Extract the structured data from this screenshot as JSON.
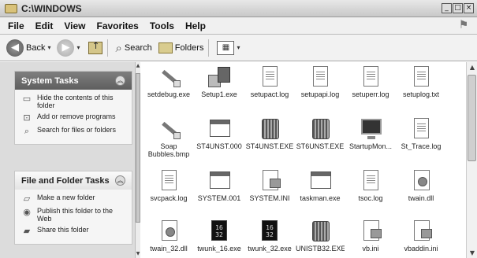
{
  "window": {
    "title": "C:\\WINDOWS",
    "controls": [
      "_",
      "□",
      "×"
    ]
  },
  "menu": {
    "items": [
      "File",
      "Edit",
      "View",
      "Favorites",
      "Tools",
      "Help"
    ]
  },
  "toolbar": {
    "back_label": "Back",
    "search_label": "Search",
    "folders_label": "Folders"
  },
  "sidebar": {
    "system_tasks": {
      "title": "System Tasks",
      "items": [
        {
          "label": "Hide the contents of this folder",
          "icon": "hide-contents-icon"
        },
        {
          "label": "Add or remove programs",
          "icon": "add-remove-programs-icon"
        },
        {
          "label": "Search for files or folders",
          "icon": "search-icon"
        }
      ]
    },
    "file_tasks": {
      "title": "File and Folder Tasks",
      "items": [
        {
          "label": "Make a new folder",
          "icon": "new-folder-icon"
        },
        {
          "label": "Publish this folder to the Web",
          "icon": "publish-web-icon"
        },
        {
          "label": "Share this folder",
          "icon": "share-folder-icon"
        }
      ]
    }
  },
  "files": [
    {
      "name": "setdebug.exe",
      "icon": "setup-debug-icon"
    },
    {
      "name": "Setup1.exe",
      "icon": "setup-exe-icon"
    },
    {
      "name": "setupact.log",
      "icon": "log-file-icon"
    },
    {
      "name": "setupapi.log",
      "icon": "log-file-icon"
    },
    {
      "name": "setuperr.log",
      "icon": "log-file-icon"
    },
    {
      "name": "setuplog.txt",
      "icon": "text-file-icon"
    },
    {
      "name": "Soap Bubbles.bmp",
      "icon": "bitmap-icon"
    },
    {
      "name": "ST4UNST.000",
      "icon": "data-file-icon"
    },
    {
      "name": "ST4UNST.EXE",
      "icon": "recycle-exe-icon"
    },
    {
      "name": "ST6UNST.EXE",
      "icon": "recycle-exe-icon"
    },
    {
      "name": "StartupMon...",
      "icon": "monitor-icon"
    },
    {
      "name": "St_Trace.log",
      "icon": "log-file-icon"
    },
    {
      "name": "svcpack.log",
      "icon": "log-file-icon"
    },
    {
      "name": "SYSTEM.001",
      "icon": "data-file-icon"
    },
    {
      "name": "SYSTEM.INI",
      "icon": "ini-file-icon"
    },
    {
      "name": "taskman.exe",
      "icon": "window-exe-icon"
    },
    {
      "name": "tsoc.log",
      "icon": "log-file-icon"
    },
    {
      "name": "twain.dll",
      "icon": "dll-file-icon"
    },
    {
      "name": "twain_32.dll",
      "icon": "dll-file-icon"
    },
    {
      "name": "twunk_16.exe",
      "icon": "twunk-exe-icon",
      "glyph": "16\n32"
    },
    {
      "name": "twunk_32.exe",
      "icon": "twunk-exe-icon",
      "glyph": "16\n32"
    },
    {
      "name": "UNISTB32.EXE",
      "icon": "recycle-exe-icon"
    },
    {
      "name": "vb.ini",
      "icon": "ini-file-icon"
    },
    {
      "name": "vbaddin.ini",
      "icon": "ini-file-icon"
    }
  ]
}
